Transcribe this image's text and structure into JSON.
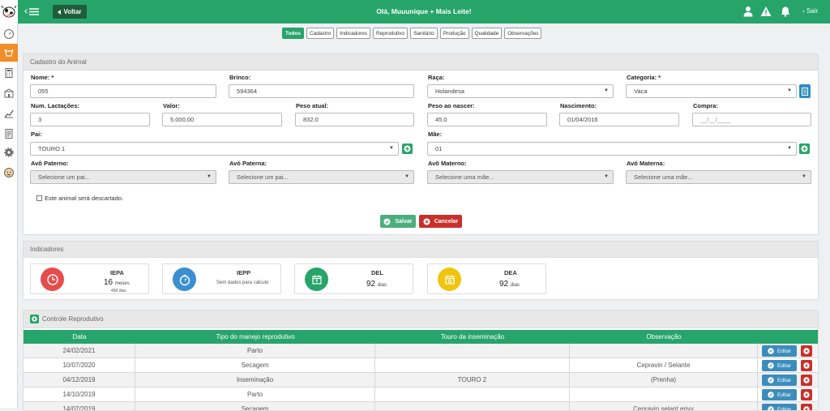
{
  "topbar": {
    "voltar_label": "Voltar",
    "greeting": "Olá, Muuunique + Mais Leite!",
    "sair_label": "Sair"
  },
  "tabs": [
    {
      "label": "Todos",
      "active": true
    },
    {
      "label": "Cadastro",
      "active": false
    },
    {
      "label": "Indicadores",
      "active": false
    },
    {
      "label": "Reprodutivo",
      "active": false
    },
    {
      "label": "Sanitário",
      "active": false
    },
    {
      "label": "Produção",
      "active": false
    },
    {
      "label": "Qualidade",
      "active": false
    },
    {
      "label": "Observações",
      "active": false
    }
  ],
  "cadastro": {
    "title": "Cadastro do Animal",
    "nome_label": "Nome: *",
    "nome_value": "055",
    "brinco_label": "Brinco:",
    "brinco_value": "594364",
    "raca_label": "Raça:",
    "raca_value": "Holandesa",
    "categoria_label": "Categoria: *",
    "categoria_value": "Vaca",
    "lactacoes_label": "Num. Lactações:",
    "lactacoes_value": "3",
    "valor_label": "Valor:",
    "valor_value": "5.000,00",
    "peso_label": "Peso atual:",
    "peso_value": "832.0",
    "peso_nascer_label": "Peso ao nascer:",
    "peso_nascer_value": "45.0",
    "nascimento_label": "Nascimento:",
    "nascimento_value": "01/04/2016",
    "compra_label": "Compra:",
    "compra_placeholder": "__/__/____",
    "pai_label": "Pai:",
    "pai_value": "TOURO 1",
    "mae_label": "Mãe:",
    "mae_value": "01",
    "avo_paterno_label": "Avô Paterno:",
    "avo_paterno_value": "Selecione um pai...",
    "ava_paterna_label": "Avó Paterna:",
    "ava_paterna_value": "Selecione um pai...",
    "avo_materno_label": "Avô Materno:",
    "avo_materno_value": "Selecione uma mãe...",
    "ava_materna_label": "Avó Materna:",
    "ava_materna_value": "Selecione uma mãe...",
    "descarte_label": "Este animal será descartado.",
    "salvar_label": "Salvar",
    "cancelar_label": "Cancelar"
  },
  "indicadores": {
    "title": "Indicadores",
    "cards": [
      {
        "name": "IEPA",
        "value": "16",
        "unit": "meses",
        "sub": "499 dias",
        "color": "#e74c4c"
      },
      {
        "name": "IEPP",
        "value": "",
        "unit": "",
        "sub": "Sem dados para cálculo",
        "color": "#3a8fd0"
      },
      {
        "name": "DEL",
        "value": "92",
        "unit": "dias",
        "sub": "",
        "color": "#27a46a"
      },
      {
        "name": "DEA",
        "value": "92",
        "unit": "dias",
        "sub": "",
        "color": "#f1c40f"
      }
    ]
  },
  "reprodutivo": {
    "title": "Controle Reprodutivo",
    "columns": [
      "Data",
      "Tipo do manejo reprodutivo",
      "Touro da inseminação",
      "Observação"
    ],
    "editar_label": "Editar",
    "rows": [
      {
        "data": "24/02/2021",
        "tipo": "Parto",
        "touro": "",
        "obs": ""
      },
      {
        "data": "10/07/2020",
        "tipo": "Secagem",
        "touro": "",
        "obs": "Cepravin / Selante"
      },
      {
        "data": "04/12/2019",
        "tipo": "Inseminação",
        "touro": "TOURO 2",
        "obs": "(Prenha)"
      },
      {
        "data": "14/10/2019",
        "tipo": "Parto",
        "touro": "",
        "obs": ""
      },
      {
        "data": "14/07/2019",
        "tipo": "Secagem",
        "touro": "",
        "obs": "Cepravin selant envy"
      }
    ]
  }
}
